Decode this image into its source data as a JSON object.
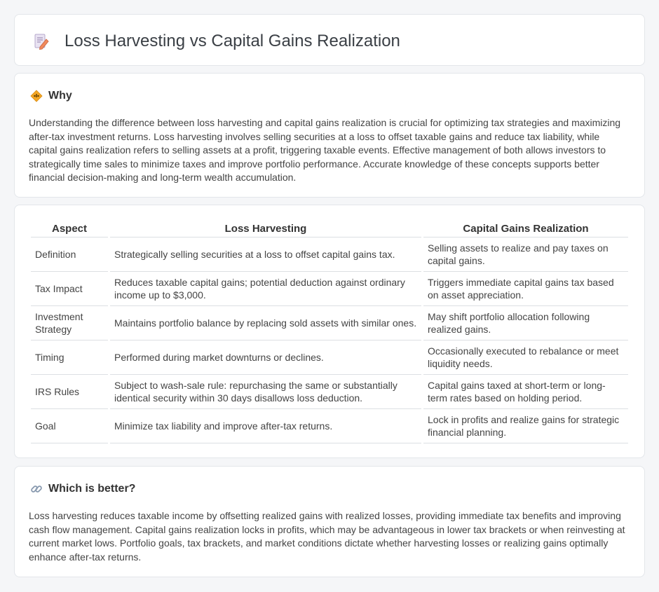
{
  "header": {
    "title": "Loss Harvesting vs Capital Gains Realization",
    "icon": "document-pencil-icon"
  },
  "why": {
    "title": "Why",
    "icon": "diamond-warning-icon",
    "body": "Understanding the difference between loss harvesting and capital gains realization is crucial for optimizing tax strategies and maximizing after-tax investment returns. Loss harvesting involves selling securities at a loss to offset taxable gains and reduce tax liability, while capital gains realization refers to selling assets at a profit, triggering taxable events. Effective management of both allows investors to strategically time sales to minimize taxes and improve portfolio performance. Accurate knowledge of these concepts supports better financial decision-making and long-term wealth accumulation."
  },
  "table": {
    "headers": [
      "Aspect",
      "Loss Harvesting",
      "Capital Gains Realization"
    ],
    "rows": [
      [
        "Definition",
        "Strategically selling securities at a loss to offset capital gains tax.",
        "Selling assets to realize and pay taxes on capital gains."
      ],
      [
        "Tax Impact",
        "Reduces taxable capital gains; potential deduction against ordinary income up to $3,000.",
        "Triggers immediate capital gains tax based on asset appreciation."
      ],
      [
        "Investment Strategy",
        "Maintains portfolio balance by replacing sold assets with similar ones.",
        "May shift portfolio allocation following realized gains."
      ],
      [
        "Timing",
        "Performed during market downturns or declines.",
        "Occasionally executed to rebalance or meet liquidity needs."
      ],
      [
        "IRS Rules",
        "Subject to wash-sale rule: repurchasing the same or substantially identical security within 30 days disallows loss deduction.",
        "Capital gains taxed at short-term or long-term rates based on holding period."
      ],
      [
        "Goal",
        "Minimize tax liability and improve after-tax returns.",
        "Lock in profits and realize gains for strategic financial planning."
      ]
    ]
  },
  "better": {
    "title": "Which is better?",
    "icon": "link-icon",
    "body": "Loss harvesting reduces taxable income by offsetting realized gains with realized losses, providing immediate tax benefits and improving cash flow management. Capital gains realization locks in profits, which may be advantageous in lower tax brackets or when reinvesting at current market lows. Portfolio goals, tax brackets, and market conditions dictate whether harvesting losses or realizing gains optimally enhance after-tax returns."
  }
}
